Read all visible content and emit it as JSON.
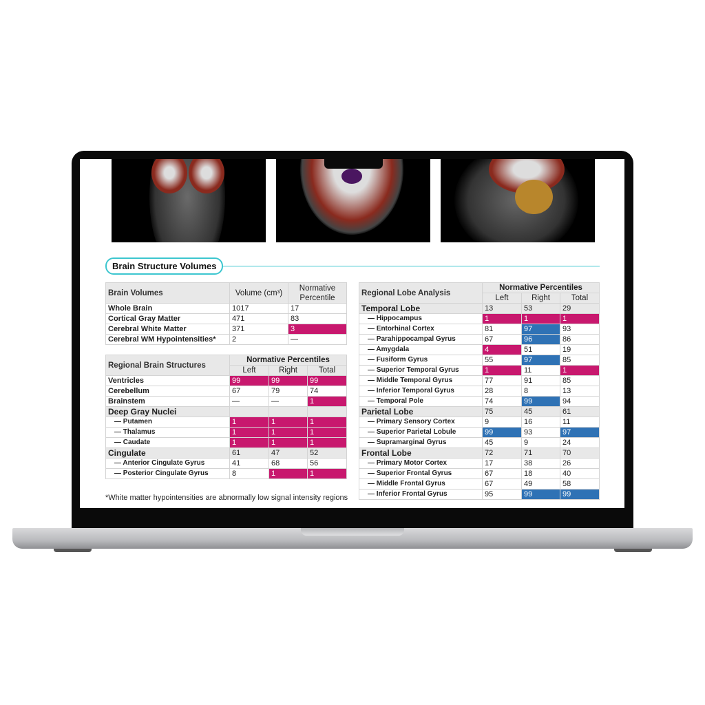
{
  "section_title": "Brain Structure Volumes",
  "colors": {
    "low": "#c8186e",
    "high": "#2f72b5",
    "accent": "#3cc6cf"
  },
  "scans": [
    "coronal-mri",
    "axial-mri",
    "sagittal-mri"
  ],
  "brain_volumes": {
    "headers": [
      "Brain Volumes",
      "Volume (cm³)",
      "Normative Percentile"
    ],
    "rows": [
      {
        "label": "Whole Brain",
        "values": [
          "1017",
          "17"
        ],
        "hl": [
          "",
          ""
        ]
      },
      {
        "label": "Cortical Gray Matter",
        "values": [
          "471",
          "83"
        ],
        "hl": [
          "",
          ""
        ]
      },
      {
        "label": "Cerebral White Matter",
        "values": [
          "371",
          "3"
        ],
        "hl": [
          "",
          "low"
        ]
      },
      {
        "label": "Cerebral WM Hypointensities*",
        "values": [
          "2",
          "—"
        ],
        "hl": [
          "",
          ""
        ]
      }
    ]
  },
  "regional_structures": {
    "title": "Regional Brain Structures",
    "group_header": "Normative Percentiles",
    "cols": [
      "Left",
      "Right",
      "Total"
    ],
    "rows": [
      {
        "label": "Ventricles",
        "values": [
          "99",
          "99",
          "99"
        ],
        "hl": [
          "low",
          "low",
          "low"
        ]
      },
      {
        "label": "Cerebellum",
        "values": [
          "67",
          "79",
          "74"
        ],
        "hl": [
          "",
          "",
          ""
        ]
      },
      {
        "label": "Brainstem",
        "values": [
          "—",
          "—",
          "1"
        ],
        "hl": [
          "",
          "",
          "low"
        ]
      },
      {
        "label": "Deep Gray Nuclei",
        "group": true,
        "values": [
          "",
          "",
          ""
        ],
        "hl": [
          "",
          "",
          ""
        ]
      },
      {
        "label": "— Putamen",
        "sub": true,
        "values": [
          "1",
          "1",
          "1"
        ],
        "hl": [
          "low",
          "low",
          "low"
        ]
      },
      {
        "label": "— Thalamus",
        "sub": true,
        "values": [
          "1",
          "1",
          "1"
        ],
        "hl": [
          "low",
          "low",
          "low"
        ]
      },
      {
        "label": "— Caudate",
        "sub": true,
        "values": [
          "1",
          "1",
          "1"
        ],
        "hl": [
          "low",
          "low",
          "low"
        ]
      },
      {
        "label": "Cingulate",
        "group": true,
        "values": [
          "61",
          "47",
          "52"
        ],
        "hl": [
          "",
          "",
          ""
        ]
      },
      {
        "label": "— Anterior Cingulate Gyrus",
        "sub": true,
        "values": [
          "41",
          "68",
          "56"
        ],
        "hl": [
          "",
          "",
          ""
        ]
      },
      {
        "label": "— Posterior Cingulate Gyrus",
        "sub": true,
        "values": [
          "8",
          "1",
          "1"
        ],
        "hl": [
          "",
          "low",
          "low"
        ]
      }
    ]
  },
  "footnote": "*White matter hypointensities are abnormally low signal intensity regions",
  "lobe_analysis": {
    "title": "Regional Lobe Analysis",
    "group_header": "Normative Percentiles",
    "cols": [
      "Left",
      "Right",
      "Total"
    ],
    "rows": [
      {
        "label": "Temporal Lobe",
        "group": true,
        "values": [
          "13",
          "53",
          "29"
        ],
        "hl": [
          "",
          "",
          ""
        ]
      },
      {
        "label": "— Hippocampus",
        "sub": true,
        "values": [
          "1",
          "1",
          "1"
        ],
        "hl": [
          "low",
          "low",
          "low"
        ]
      },
      {
        "label": "— Entorhinal Cortex",
        "sub": true,
        "values": [
          "81",
          "97",
          "93"
        ],
        "hl": [
          "",
          "high",
          ""
        ]
      },
      {
        "label": "— Parahippocampal Gyrus",
        "sub": true,
        "values": [
          "67",
          "96",
          "86"
        ],
        "hl": [
          "",
          "high",
          ""
        ]
      },
      {
        "label": "— Amygdala",
        "sub": true,
        "values": [
          "4",
          "51",
          "19"
        ],
        "hl": [
          "low",
          "",
          ""
        ]
      },
      {
        "label": "— Fusiform Gyrus",
        "sub": true,
        "values": [
          "55",
          "97",
          "85"
        ],
        "hl": [
          "",
          "high",
          ""
        ]
      },
      {
        "label": "— Superior Temporal Gyrus",
        "sub": true,
        "values": [
          "1",
          "11",
          "1"
        ],
        "hl": [
          "low",
          "",
          "low"
        ]
      },
      {
        "label": "— Middle Temporal Gyrus",
        "sub": true,
        "values": [
          "77",
          "91",
          "85"
        ],
        "hl": [
          "",
          "",
          ""
        ]
      },
      {
        "label": "— Inferior Temporal Gyrus",
        "sub": true,
        "values": [
          "28",
          "8",
          "13"
        ],
        "hl": [
          "",
          "",
          ""
        ]
      },
      {
        "label": "— Temporal Pole",
        "sub": true,
        "values": [
          "74",
          "99",
          "94"
        ],
        "hl": [
          "",
          "high",
          ""
        ]
      },
      {
        "label": "Parietal Lobe",
        "group": true,
        "values": [
          "75",
          "45",
          "61"
        ],
        "hl": [
          "",
          "",
          ""
        ]
      },
      {
        "label": "— Primary Sensory Cortex",
        "sub": true,
        "values": [
          "9",
          "16",
          "11"
        ],
        "hl": [
          "",
          "",
          ""
        ]
      },
      {
        "label": "— Superior Parietal Lobule",
        "sub": true,
        "values": [
          "99",
          "93",
          "97"
        ],
        "hl": [
          "high",
          "",
          "high"
        ]
      },
      {
        "label": "— Supramarginal Gyrus",
        "sub": true,
        "values": [
          "45",
          "9",
          "24"
        ],
        "hl": [
          "",
          "",
          ""
        ]
      },
      {
        "label": "Frontal Lobe",
        "group": true,
        "values": [
          "72",
          "71",
          "70"
        ],
        "hl": [
          "",
          "",
          ""
        ]
      },
      {
        "label": "— Primary Motor Cortex",
        "sub": true,
        "values": [
          "17",
          "38",
          "26"
        ],
        "hl": [
          "",
          "",
          ""
        ]
      },
      {
        "label": "— Superior Frontal Gyrus",
        "sub": true,
        "values": [
          "67",
          "18",
          "40"
        ],
        "hl": [
          "",
          "",
          ""
        ]
      },
      {
        "label": "— Middle Frontal Gyrus",
        "sub": true,
        "values": [
          "67",
          "49",
          "58"
        ],
        "hl": [
          "",
          "",
          ""
        ]
      },
      {
        "label": "— Inferior Frontal Gyrus",
        "sub": true,
        "values": [
          "95",
          "99",
          "99"
        ],
        "hl": [
          "",
          "high",
          "high"
        ]
      }
    ]
  }
}
